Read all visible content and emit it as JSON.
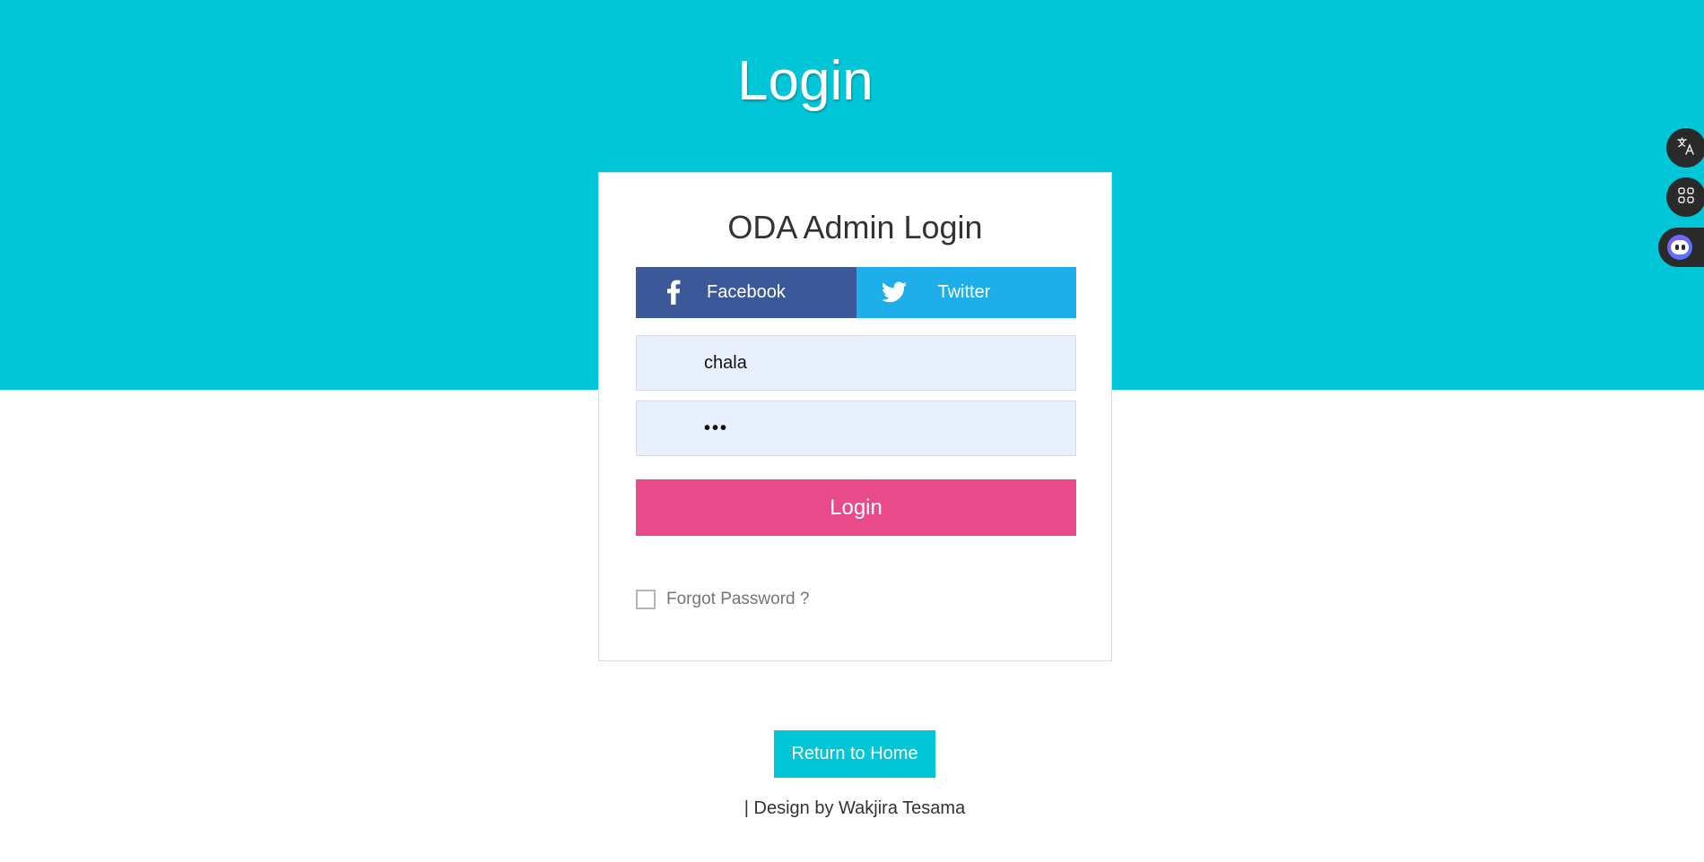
{
  "page": {
    "title": "Login"
  },
  "card": {
    "title": "ODA Admin Login",
    "social": {
      "facebook_label": "Facebook",
      "twitter_label": "Twitter"
    },
    "username": {
      "value": "chala"
    },
    "password": {
      "masked_value": "•••"
    },
    "login_label": "Login",
    "forgot_label": "Forgot Password ?"
  },
  "footer": {
    "home_label": "Return to Home",
    "credit": "| Design by Wakjira Tesama"
  },
  "colors": {
    "hero": "#00c6d7",
    "facebook": "#3b5998",
    "twitter": "#1eaee9",
    "login_button": "#e94b8a",
    "input_bg": "#e8f0fd"
  },
  "floating_tools": {
    "icons": [
      "translate-icon",
      "apps-icon",
      "assistant-bot-icon"
    ]
  }
}
